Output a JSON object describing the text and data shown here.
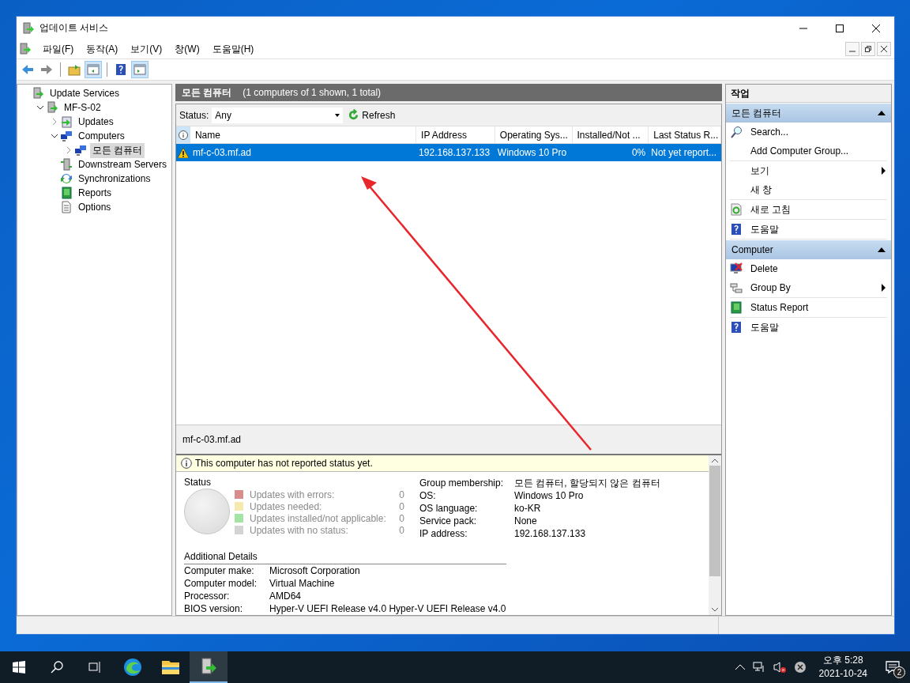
{
  "window": {
    "title": "업데이트 서비스"
  },
  "menu": [
    "파일(F)",
    "동작(A)",
    "보기(V)",
    "창(W)",
    "도움말(H)"
  ],
  "toolbar": [
    {
      "kind": "back",
      "pressed": false
    },
    {
      "kind": "forward",
      "pressed": false
    },
    {
      "kind": "up",
      "pressed": false
    },
    {
      "kind": "tree-pane",
      "pressed": true
    },
    {
      "kind": "help",
      "pressed": false
    },
    {
      "kind": "action-pane",
      "pressed": true
    }
  ],
  "tree": [
    {
      "label": "Update Services",
      "kind": "server",
      "selected": false,
      "children": [
        {
          "label": "MF-S-02",
          "kind": "server",
          "expanded": true,
          "selected": false,
          "children": [
            {
              "label": "Updates",
              "kind": "updates",
              "expanded": false,
              "selected": false
            },
            {
              "label": "Computers",
              "kind": "computers",
              "expanded": true,
              "selected": false,
              "children": [
                {
                  "label": "모든 컴퓨터",
                  "kind": "computers",
                  "expanded": false,
                  "selected": true
                }
              ]
            },
            {
              "label": "Downstream Servers",
              "kind": "downstream",
              "selected": false
            },
            {
              "label": "Synchronizations",
              "kind": "sync",
              "selected": false
            },
            {
              "label": "Reports",
              "kind": "report",
              "selected": false
            },
            {
              "label": "Options",
              "kind": "options",
              "selected": false
            }
          ]
        }
      ]
    }
  ],
  "center": {
    "title": "모든 컴퓨터",
    "info": "(1 computers of 1 shown, 1 total)",
    "status_label": "Status:",
    "status_value": "Any",
    "refresh": "Refresh",
    "columns": [
      "Name",
      "IP Address",
      "Operating Sys...",
      "Installed/Not ...",
      "Last Status R..."
    ],
    "rows": [
      {
        "warning": true,
        "selected": true,
        "cells": [
          "mf-c-03.mf.ad",
          "192.168.137.133",
          "Windows 10 Pro",
          "0%",
          "Not yet report..."
        ]
      }
    ],
    "detail_title": "mf-c-03.mf.ad",
    "notice": "This computer has not reported status yet.",
    "status_heading": "Status",
    "legend": [
      {
        "label": "Updates with errors:",
        "count": "0",
        "color": "#d98c8c"
      },
      {
        "label": "Updates needed:",
        "count": "0",
        "color": "#f5e9b0"
      },
      {
        "label": "Updates installed/not applicable:",
        "count": "0",
        "color": "#a4e3a4"
      },
      {
        "label": "Updates with no status:",
        "count": "0",
        "color": "#d4d4d4"
      }
    ],
    "properties": [
      {
        "label": "Group membership:",
        "value": "모든 컴퓨터, 할당되지 않은 컴퓨터"
      },
      {
        "label": "OS:",
        "value": "Windows 10 Pro"
      },
      {
        "label": "OS language:",
        "value": "ko-KR"
      },
      {
        "label": "Service pack:",
        "value": "None"
      },
      {
        "label": "IP address:",
        "value": "192.168.137.133"
      }
    ],
    "additional_heading": "Additional Details",
    "additional": [
      {
        "label": "Computer make:",
        "value": "Microsoft Corporation"
      },
      {
        "label": "Computer model:",
        "value": "Virtual Machine"
      },
      {
        "label": "Processor:",
        "value": "AMD64"
      },
      {
        "label": "BIOS version:",
        "value": "Hyper-V UEFI Release v4.0 Hyper-V UEFI Release v4.0"
      }
    ]
  },
  "actions": {
    "title": "작업",
    "sections": [
      {
        "title": "모든 컴퓨터",
        "expanded": true,
        "groups": [
          [
            {
              "label": "Search...",
              "kind": "search",
              "submenu": false
            },
            {
              "label": "Add Computer Group...",
              "kind": "plain",
              "submenu": false
            }
          ],
          [
            {
              "label": "보기",
              "kind": "plain",
              "submenu": true
            },
            {
              "label": "새 창",
              "kind": "plain",
              "submenu": false
            }
          ],
          [
            {
              "label": "새로 고침",
              "kind": "refresh",
              "submenu": false
            }
          ],
          [
            {
              "label": "도움말",
              "kind": "help",
              "submenu": false
            }
          ]
        ]
      },
      {
        "title": "Computer",
        "expanded": true,
        "groups": [
          [
            {
              "label": "Delete",
              "kind": "delete",
              "submenu": false
            },
            {
              "label": "Group By",
              "kind": "groupby",
              "submenu": true
            }
          ],
          [
            {
              "label": "Status Report",
              "kind": "report",
              "submenu": false
            }
          ],
          [
            {
              "label": "도움말",
              "kind": "help",
              "submenu": false
            }
          ]
        ]
      }
    ]
  },
  "taskbar": {
    "apps": [
      {
        "kind": "edge",
        "selected": false
      },
      {
        "kind": "explorer",
        "selected": false
      },
      {
        "kind": "wsus",
        "selected": true
      }
    ],
    "time": "오후 5:28",
    "date": "2021-10-24",
    "notifications": "2"
  }
}
